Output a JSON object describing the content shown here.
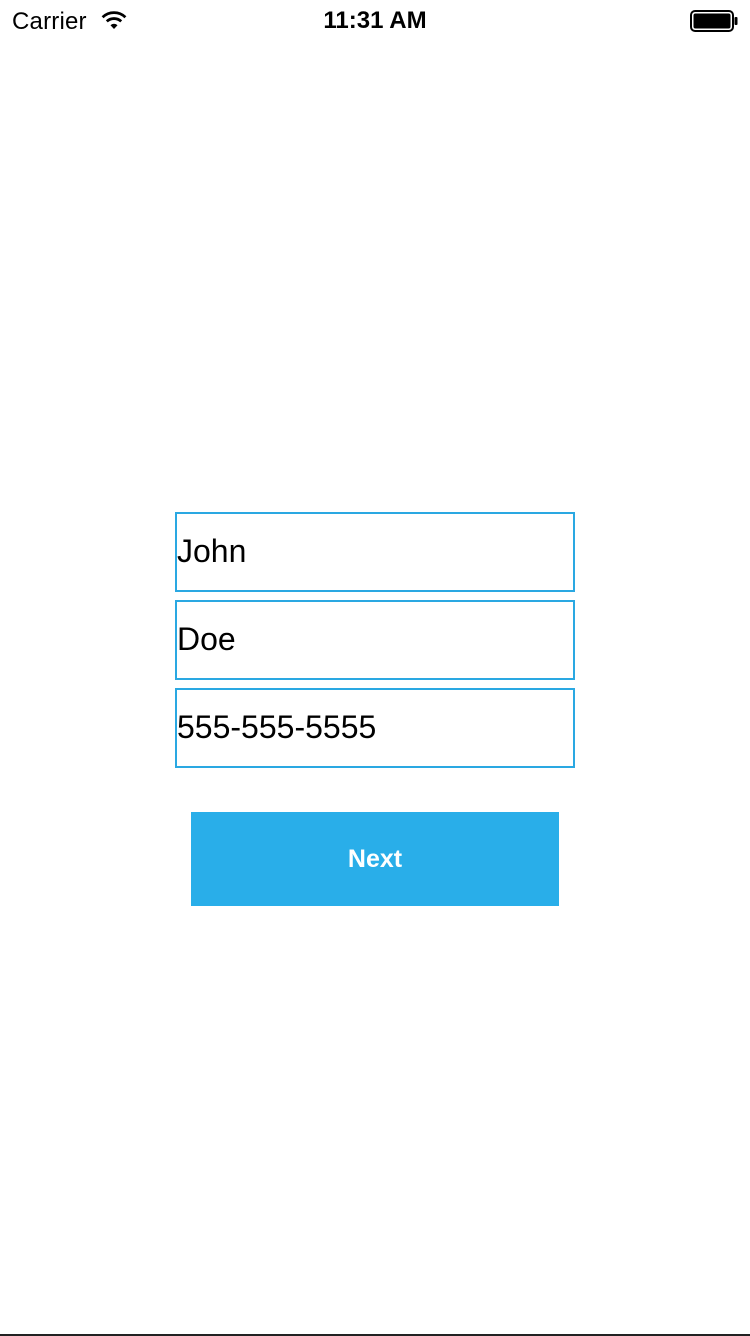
{
  "status_bar": {
    "carrier": "Carrier",
    "time": "11:31 AM",
    "wifi_icon": "wifi-icon",
    "battery_icon": "battery-full-icon"
  },
  "form": {
    "first_name": "John",
    "last_name": "Doe",
    "phone": "555-555-5555"
  },
  "next_button": {
    "label": "Next"
  },
  "colors": {
    "field_border": "#2aa8e2",
    "button_background": "#29aee9",
    "button_text": "#ffffff"
  }
}
